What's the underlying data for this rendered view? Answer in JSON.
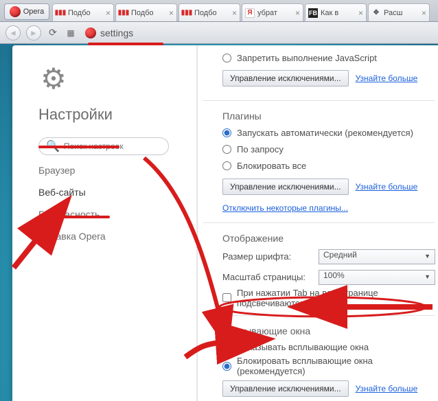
{
  "app_name": "Opera",
  "tabs": [
    {
      "label": "Подбо"
    },
    {
      "label": "Подбо"
    },
    {
      "label": "Подбо"
    },
    {
      "label": "убрат"
    },
    {
      "label": "Как в"
    },
    {
      "label": "Расш"
    }
  ],
  "address_bar": {
    "value": "settings"
  },
  "sidebar": {
    "title": "Настройки",
    "search_placeholder": "Поиск настроек",
    "items": [
      "Браузер",
      "Веб-сайты",
      "Безопасность",
      "Справка Opera"
    ],
    "active_index": 1
  },
  "content": {
    "js_block_label": "Запретить выполнение JavaScript",
    "manage_exceptions": "Управление исключениями...",
    "learn_more": "Узнайте больше",
    "plugins_title": "Плагины",
    "plugins_opts": [
      "Запускать автоматически (рекомендуется)",
      "По запросу",
      "Блокировать все"
    ],
    "plugins_disable_link": "Отключить некоторые плагины...",
    "display_title": "Отображение",
    "font_size_label": "Размер шрифта:",
    "font_size_value": "Средний",
    "zoom_label": "Масштаб страницы:",
    "zoom_value": "100%",
    "tab_highlight": "При нажатии Tab на веб-странице подсвечиваются",
    "popups_title": "Всплывающие окна",
    "popups_opts": [
      "Показывать всплывающие окна",
      "Блокировать всплывающие окна (рекомендуется)"
    ]
  }
}
